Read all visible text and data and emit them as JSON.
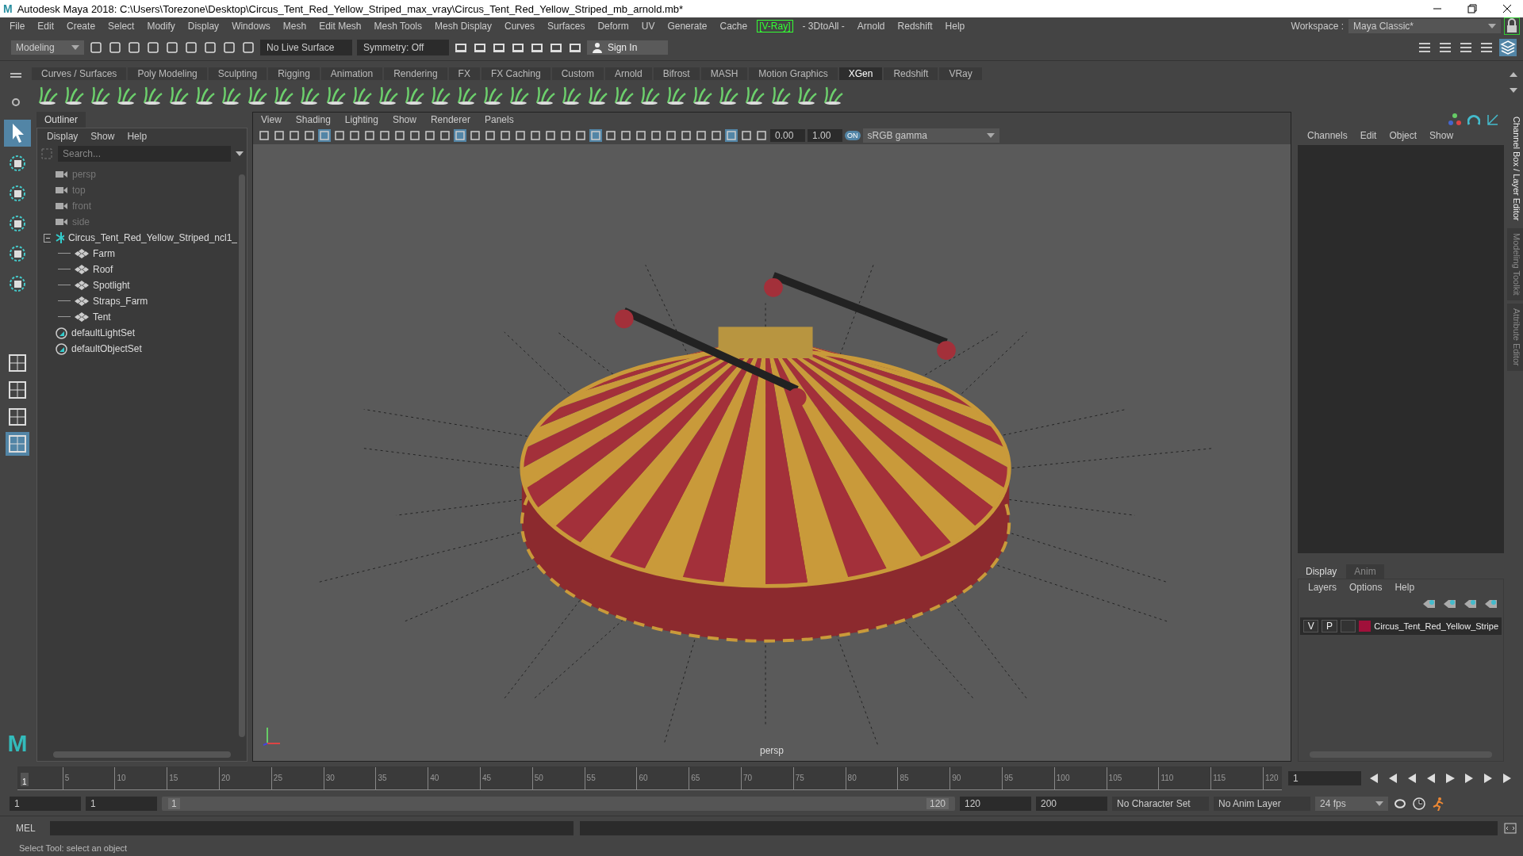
{
  "window": {
    "logo": "M",
    "title": "Autodesk Maya 2018: C:\\Users\\Torezone\\Desktop\\Circus_Tent_Red_Yellow_Striped_max_vray\\Circus_Tent_Red_Yellow_Striped_mb_arnold.mb*"
  },
  "menu_bar": [
    {
      "label": "File",
      "kind": "menu"
    },
    {
      "label": "Edit",
      "kind": "menu"
    },
    {
      "label": "Create",
      "kind": "menu"
    },
    {
      "label": "Select",
      "kind": "menu"
    },
    {
      "label": "Modify",
      "kind": "menu"
    },
    {
      "label": "Display",
      "kind": "menu"
    },
    {
      "label": "Windows",
      "kind": "menu"
    },
    {
      "label": "Mesh",
      "kind": "menu"
    },
    {
      "label": "Edit Mesh",
      "kind": "menu"
    },
    {
      "label": "Mesh Tools",
      "kind": "menu"
    },
    {
      "label": "Mesh Display",
      "kind": "menu"
    },
    {
      "label": "Curves",
      "kind": "menu"
    },
    {
      "label": "Surfaces",
      "kind": "menu"
    },
    {
      "label": "Deform",
      "kind": "menu"
    },
    {
      "label": "UV",
      "kind": "menu"
    },
    {
      "label": "Generate",
      "kind": "menu"
    },
    {
      "label": "Cache",
      "kind": "menu"
    },
    {
      "label": "[V-Ray]",
      "kind": "plugin"
    },
    {
      "label": "- 3DtoAll -",
      "kind": "menu"
    },
    {
      "label": "Arnold",
      "kind": "menu"
    },
    {
      "label": "Redshift",
      "kind": "menu"
    },
    {
      "label": "Help",
      "kind": "menu"
    }
  ],
  "status_line": {
    "mode": "Modeling",
    "live_surface": "No Live Surface",
    "symmetry": "Symmetry: Off",
    "sign_in": "Sign In",
    "workspace_label": "Workspace :",
    "workspace": "Maya Classic*"
  },
  "shelf_tabs": [
    {
      "label": "Curves / Surfaces",
      "selected": false
    },
    {
      "label": "Poly Modeling",
      "selected": false
    },
    {
      "label": "Sculpting",
      "selected": false
    },
    {
      "label": "Rigging",
      "selected": false
    },
    {
      "label": "Animation",
      "selected": false
    },
    {
      "label": "Rendering",
      "selected": false
    },
    {
      "label": "FX",
      "selected": false
    },
    {
      "label": "FX Caching",
      "selected": false
    },
    {
      "label": "Custom",
      "selected": false
    },
    {
      "label": "Arnold",
      "selected": false
    },
    {
      "label": "Bifrost",
      "selected": false
    },
    {
      "label": "MASH",
      "selected": false
    },
    {
      "label": "Motion Graphics",
      "selected": false
    },
    {
      "label": "XGen",
      "selected": true
    },
    {
      "label": "Redshift",
      "selected": false
    },
    {
      "label": "VRay",
      "selected": false
    }
  ],
  "outliner": {
    "title": "Outliner",
    "menu": [
      "Display",
      "Show",
      "Help"
    ],
    "search_placeholder": "Search...",
    "items": [
      {
        "label": "persp",
        "kind": "camera"
      },
      {
        "label": "top",
        "kind": "camera"
      },
      {
        "label": "front",
        "kind": "camera"
      },
      {
        "label": "side",
        "kind": "camera"
      },
      {
        "label": "Circus_Tent_Red_Yellow_Striped_ncl1_",
        "kind": "group",
        "expanded": true,
        "children": [
          {
            "label": "Farm",
            "kind": "mesh"
          },
          {
            "label": "Roof",
            "kind": "mesh"
          },
          {
            "label": "Spotlight",
            "kind": "mesh"
          },
          {
            "label": "Straps_Farm",
            "kind": "mesh"
          },
          {
            "label": "Tent",
            "kind": "mesh"
          }
        ]
      },
      {
        "label": "defaultLightSet",
        "kind": "set"
      },
      {
        "label": "defaultObjectSet",
        "kind": "set"
      }
    ]
  },
  "viewport": {
    "menu": [
      "View",
      "Shading",
      "Lighting",
      "Show",
      "Renderer",
      "Panels"
    ],
    "exposure": "0.00",
    "gamma": "1.00",
    "color_space_toggle": "ON",
    "color_space": "sRGB gamma",
    "camera": "persp"
  },
  "channel_box": {
    "menu": [
      "Channels",
      "Edit",
      "Object",
      "Show"
    ]
  },
  "layer_editor": {
    "tabs": [
      {
        "label": "Display",
        "selected": true
      },
      {
        "label": "Anim",
        "selected": false
      }
    ],
    "menu": [
      "Layers",
      "Options",
      "Help"
    ],
    "layers": [
      {
        "visible": "V",
        "playback": "P",
        "color": "#a0103a",
        "name": "Circus_Tent_Red_Yellow_Stripe"
      }
    ]
  },
  "side_tabs": [
    {
      "label": "Channel Box / Layer Editor",
      "selected": true
    },
    {
      "label": "Modeling Toolkit",
      "selected": false
    },
    {
      "label": "Attribute Editor",
      "selected": false
    }
  ],
  "toolbox": {
    "logo": "M"
  },
  "time_slider": {
    "current": "1",
    "level": 0,
    "ticks": [
      "5",
      "10",
      "15",
      "20",
      "25",
      "30",
      "35",
      "40",
      "45",
      "50",
      "55",
      "60",
      "65",
      "70",
      "75",
      "80",
      "85",
      "90",
      "95",
      "100",
      "105",
      "110",
      "115",
      "120"
    ],
    "current_field": "1"
  },
  "range": {
    "level": 1,
    "start": "1",
    "playback_start": "1",
    "slider_start": "1",
    "slider_end": "120",
    "playback_end": "120",
    "end": "200",
    "character_set": "No Character Set",
    "anim_layer": "No Anim Layer",
    "fps": "24 fps"
  },
  "command_line": {
    "label": "MEL"
  },
  "help_line": "Select Tool: select an object"
}
